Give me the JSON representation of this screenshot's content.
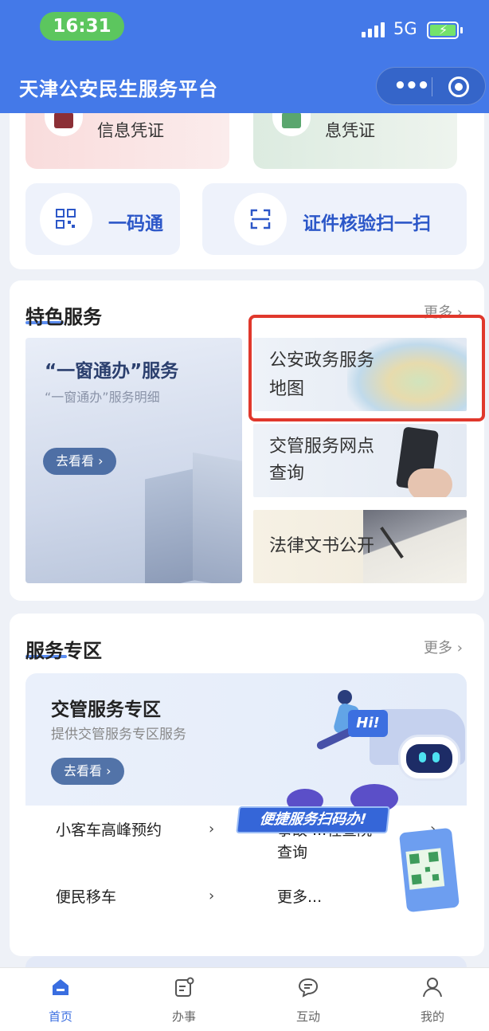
{
  "status_bar": {
    "time": "16:31",
    "network": "5G"
  },
  "header": {
    "title": "天津公安民生服务平台",
    "more_glyph": "•••"
  },
  "quick_access": {
    "certs": [
      {
        "label": "信息凭证",
        "color": "#8b2f36"
      },
      {
        "label": "息凭证",
        "color": "#5aa66e"
      }
    ],
    "tiles": [
      {
        "label": "一码通"
      },
      {
        "label": "证件核验扫一扫"
      }
    ]
  },
  "featured": {
    "title": "特色服务",
    "more_label": "更多 ›",
    "main_card": {
      "title": "“一窗通办”服务",
      "subtitle": "“一窗通办”服务明细",
      "button": "去看看 ›"
    },
    "items": [
      {
        "label_line1": "公安政务服务",
        "label_line2": "地图"
      },
      {
        "label_line1": "交管服务网点",
        "label_line2": "查询"
      },
      {
        "label_line1": "法律文书公开",
        "label_line2": ""
      }
    ]
  },
  "service_zone": {
    "title": "服务专区",
    "more_label": "更多 ›",
    "banner": {
      "title": "交管服务专区",
      "subtitle": "提供交管服务专区服务",
      "button": "去看看 ›",
      "hi_badge": "Hi!",
      "scan_banner": "便捷服务扫码办!"
    },
    "links": [
      {
        "label": "小客车高峰预约",
        "chevron": "›"
      },
      {
        "label_line1": "事故 ...程查院",
        "label_line2": "查询",
        "chevron": "›"
      },
      {
        "label": "便民移车",
        "chevron": "›"
      },
      {
        "label": "更多...",
        "chevron": ""
      }
    ]
  },
  "tabbar": {
    "active_color": "#3a6ee0",
    "tabs": [
      {
        "label": "首页",
        "icon": "home-icon",
        "active": true
      },
      {
        "label": "办事",
        "icon": "service-icon",
        "active": false
      },
      {
        "label": "互动",
        "icon": "chat-icon",
        "active": false
      },
      {
        "label": "我的",
        "icon": "user-icon",
        "active": false
      }
    ]
  }
}
